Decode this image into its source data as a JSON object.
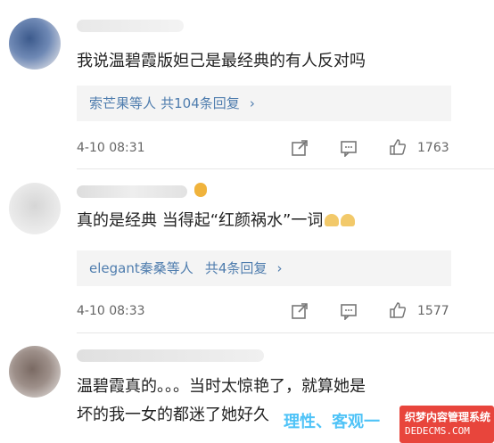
{
  "comments": [
    {
      "text": "我说温碧霞版妲己是最经典的有人反对吗",
      "reply_names": "索芒果等人",
      "reply_tail": "共104条回复",
      "time": "4-10 08:31",
      "likes": "1763"
    },
    {
      "text": "真的是经典 当得起“红颜祸水”一词",
      "reply_names": "elegant秦桑等人",
      "reply_tail": "共4条回复",
      "time": "4-10 08:33",
      "likes": "1577"
    },
    {
      "text_line1": "温碧霞真的。。。当时太惊艳了，就算她是",
      "text_line2": "坏的我一女的都迷了她好久"
    }
  ],
  "icons": {
    "share": "share-icon",
    "comment": "comment-icon",
    "like": "thumbs-up-icon",
    "reply_arrow": "›"
  },
  "watermark": {
    "text": "理性、客观一",
    "badge_line1": "织梦内容管理系统",
    "badge_line2": "DEDECMS.COM"
  },
  "colors": {
    "link": "#4f7dae",
    "watermark_text": "#4fc3f7",
    "badge": "#e8453c"
  }
}
